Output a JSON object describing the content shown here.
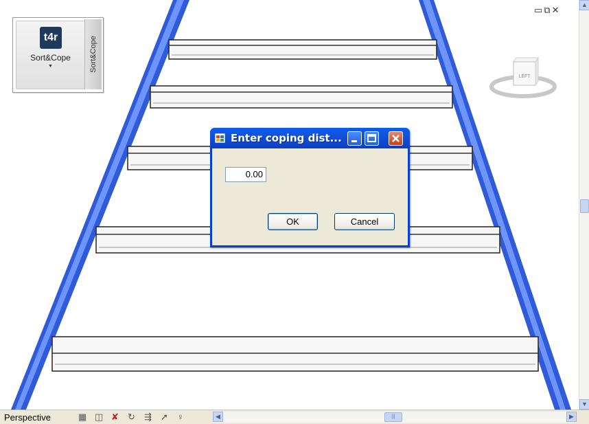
{
  "viewport": {
    "perspective_label": "Perspective"
  },
  "ribbon": {
    "icon_text": "t4r",
    "tool_label": "Sort&Cope",
    "panel_title": "Sort&Cope"
  },
  "viewcube": {
    "face_label": "LEFT"
  },
  "dialog": {
    "title": "Enter coping dist...",
    "input_value": "0.00",
    "ok_label": "OK",
    "cancel_label": "Cancel"
  },
  "colors": {
    "beam_blue": "#3c6ae0",
    "dialog_title_blue": "#0a5df0",
    "dialog_body": "#ece9d8"
  },
  "icons": {
    "window_controls": [
      "minimize-icon",
      "restore-icon",
      "close-icon"
    ],
    "status_tools": [
      "grid-icon",
      "cube-icon",
      "select-remove-icon",
      "orbit-icon",
      "walk-icon",
      "fly-icon",
      "light-icon"
    ]
  }
}
